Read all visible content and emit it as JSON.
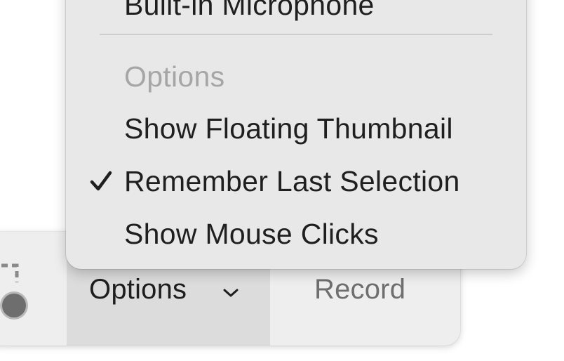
{
  "menu": {
    "cut_item_label": "Built-in Microphone",
    "section_header": "Options",
    "items": [
      {
        "label": "Show Floating Thumbnail",
        "checked": false
      },
      {
        "label": "Remember Last Selection",
        "checked": true
      },
      {
        "label": "Show Mouse Clicks",
        "checked": false
      }
    ],
    "checkmark_icon": "checkmark-icon"
  },
  "toolbar": {
    "options_label": "Options",
    "options_icon": "chevron-down-icon",
    "record_label": "Record",
    "capture_icon": "capture-selection-icon"
  }
}
